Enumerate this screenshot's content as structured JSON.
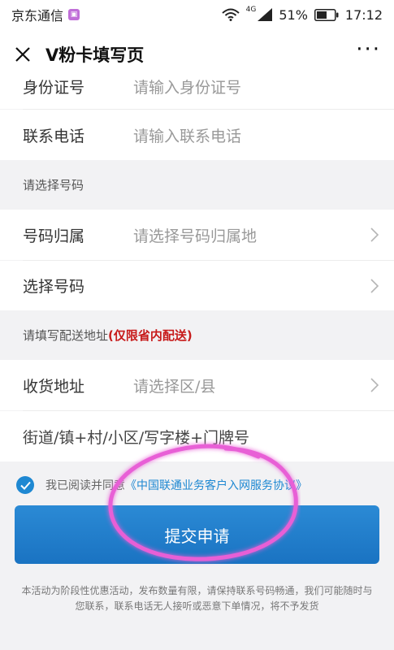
{
  "status_bar": {
    "carrier": "京东通信",
    "network": "4G",
    "battery": "51%",
    "time": "17:12"
  },
  "nav": {
    "title": "V粉卡填写页",
    "more": "···"
  },
  "form": {
    "id_row": {
      "label": "身份证号",
      "placeholder": "请输入身份证号"
    },
    "phone_row": {
      "label": "联系电话",
      "placeholder": "请输入联系电话"
    },
    "number_section": "请选择号码",
    "number_location": {
      "label": "号码归属",
      "placeholder": "请选择号码归属地"
    },
    "number_pick": {
      "label": "选择号码",
      "placeholder": ""
    },
    "delivery_section": {
      "text": "请填写配送地址",
      "accent": "(仅限省内配送)"
    },
    "address_row": {
      "label": "收货地址",
      "placeholder": "请选择区/县"
    },
    "street_row": {
      "placeholder": "街道/镇+村/小区/写字楼+门牌号"
    }
  },
  "agreement": {
    "prefix": "我已阅读并同意",
    "link": "《中国联通业务客户入网服务协议》"
  },
  "submit_label": "提交申请",
  "notice": "本活动为阶段性优惠活动，发布数量有限，请保持联系号码畅通，我们可能随时与您联系，联系电话无人接听或恶意下单情况，将不予发货",
  "colors": {
    "accent": "#1e88d2",
    "warning": "#c71b1b",
    "annotation": "#e040c8"
  },
  "icons": [
    "close-icon",
    "more-icon",
    "chevron-right-icon",
    "checkmark-icon",
    "wifi-icon",
    "signal-icon",
    "battery-icon"
  ]
}
